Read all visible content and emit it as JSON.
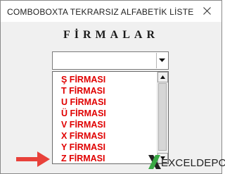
{
  "window": {
    "title": "COMBOBOXTA TEKRARSIZ ALFABETİK LİSTE"
  },
  "heading": "FİRMALAR",
  "combobox": {
    "value": ""
  },
  "dropdown": {
    "items": [
      "Ş FİRMASI",
      "T FİRMASI",
      "U FİRMASI",
      "Ü FİRMASI",
      "V FİRMASI",
      "X FİRMASI",
      "Y FİRMASI",
      "Z FİRMASI"
    ]
  },
  "logo": {
    "text_excel": "EXCEL",
    "text_depo": "DEPO"
  },
  "colors": {
    "item_text": "#e00000",
    "arrow": "#e8413a",
    "logo_green": "#3aa845"
  },
  "icons": [
    "close-icon",
    "dropdown-arrow-icon",
    "scroll-up-icon",
    "scroll-down-icon",
    "pointer-arrow-icon",
    "logo-x-icon"
  ]
}
